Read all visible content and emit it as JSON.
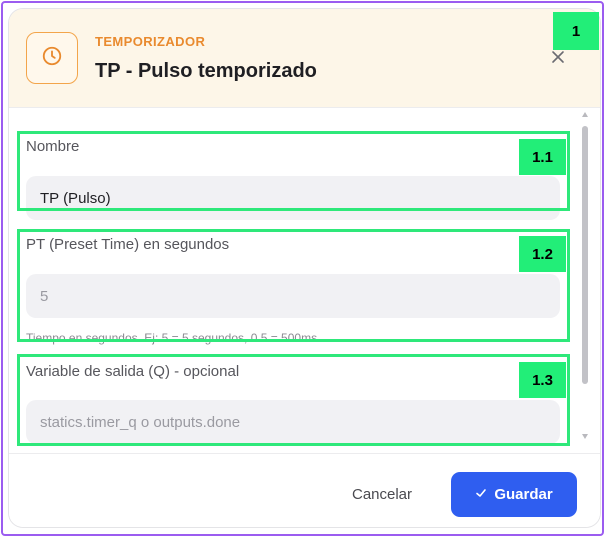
{
  "dialog": {
    "kicker": "TEMPORIZADOR",
    "title": "TP - Pulso temporizado"
  },
  "fields": {
    "name": {
      "label": "Nombre",
      "value": "TP (Pulso)",
      "placeholder": ""
    },
    "preset_time": {
      "label": "PT (Preset Time) en segundos",
      "value": "",
      "placeholder": "5",
      "help": "Tiempo en segundos. Ej: 5 = 5 segundos, 0.5 = 500ms"
    },
    "output_variable": {
      "label": "Variable de salida (Q) - opcional",
      "value": "",
      "placeholder": "statics.timer_q o outputs.done"
    }
  },
  "footer": {
    "cancel_label": "Cancelar",
    "save_label": "Guardar"
  },
  "annotations": {
    "tag_1": "1",
    "tag_1_1": "1.1",
    "tag_1_2": "1.2",
    "tag_1_3": "1.3"
  },
  "colors": {
    "accent_orange": "#f3a54b",
    "primary_blue": "#2f5ef0",
    "annotation_green": "#22ee78",
    "frame_purple": "#9b5cf0"
  },
  "icons": {
    "header": "clock-icon",
    "close": "close-icon",
    "save": "check-icon"
  }
}
